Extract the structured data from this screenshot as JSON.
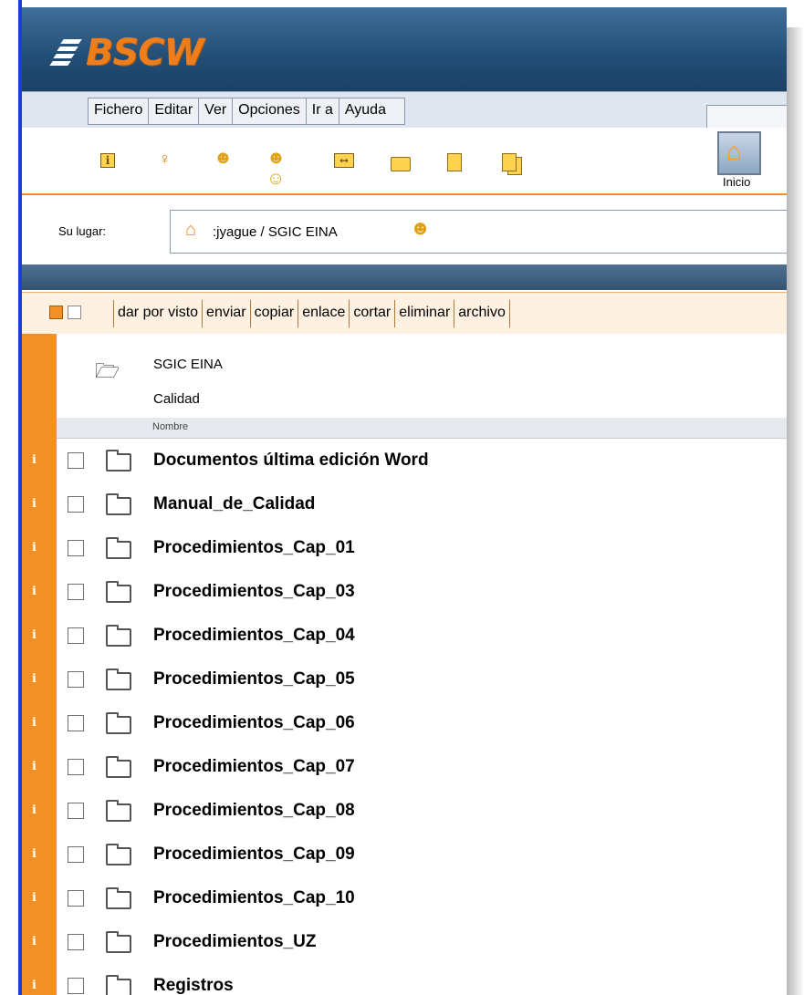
{
  "logo": {
    "text": "BSCW"
  },
  "menu": [
    "Fichero",
    "Editar",
    "Ver",
    "Opciones",
    "Ir a",
    "Ayuda"
  ],
  "toolbar": {
    "icons": [
      "info-icon",
      "key-icon",
      "user-icon",
      "users-icon",
      "move-icon",
      "folder-icon",
      "document-icon",
      "documents-icon"
    ],
    "home_label": "Inicio"
  },
  "location": {
    "label": "Su lugar:",
    "path": ":jyague / SGIC EINA"
  },
  "actions": [
    "dar por visto",
    "enviar",
    "copiar",
    "enlace",
    "cortar",
    "eliminar",
    "archivo"
  ],
  "parent": {
    "name": "SGIC EINA",
    "description": "Calidad"
  },
  "list_header": "Nombre",
  "info_glyph": "i",
  "rows": [
    "Documentos última edición Word",
    "Manual_de_Calidad",
    "Procedimientos_Cap_01",
    "Procedimientos_Cap_03",
    "Procedimientos_Cap_04",
    "Procedimientos_Cap_05",
    "Procedimientos_Cap_06",
    "Procedimientos_Cap_07",
    "Procedimientos_Cap_08",
    "Procedimientos_Cap_09",
    "Procedimientos_Cap_10",
    "Procedimientos_UZ",
    "Registros"
  ],
  "colors": {
    "accent": "#f39025",
    "banner": "#224d75",
    "brand": "#ee7d1c"
  }
}
